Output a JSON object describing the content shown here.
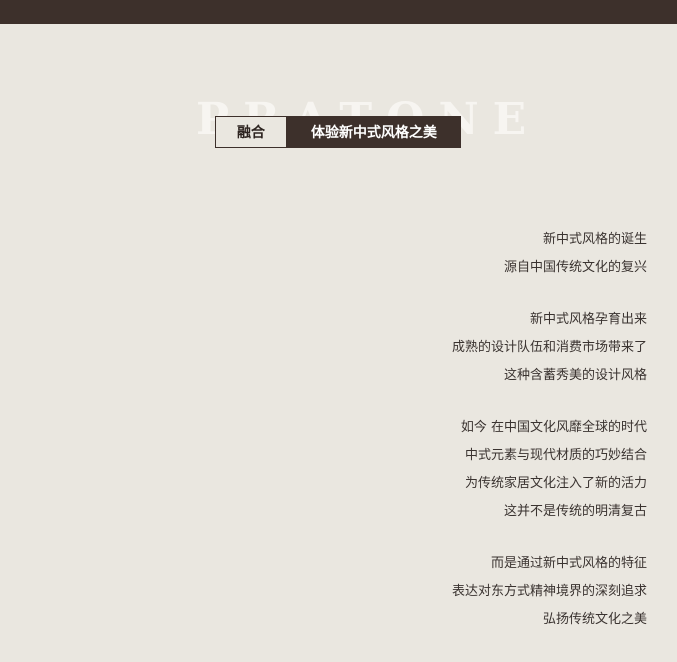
{
  "header": {
    "watermark": "PRATONE",
    "label": "融合",
    "title": "体验新中式风格之美"
  },
  "poem": {
    "stanzas": [
      [
        "新中式风格的诞生",
        "源自中国传统文化的复兴"
      ],
      [
        "新中式风格孕育出来",
        "成熟的设计队伍和消费市场带来了",
        "这种含蓄秀美的设计风格"
      ],
      [
        "如今 在中国文化风靡全球的时代",
        "中式元素与现代材质的巧妙结合",
        "为传统家居文化注入了新的活力",
        "这并不是传统的明清复古"
      ],
      [
        "而是通过新中式风格的特征",
        "表达对东方式精神境界的深刻追求",
        "弘扬传统文化之美"
      ]
    ]
  },
  "colors": {
    "background": "#eae7e0",
    "dark_brown": "#3d302b",
    "text": "#3a3330"
  }
}
